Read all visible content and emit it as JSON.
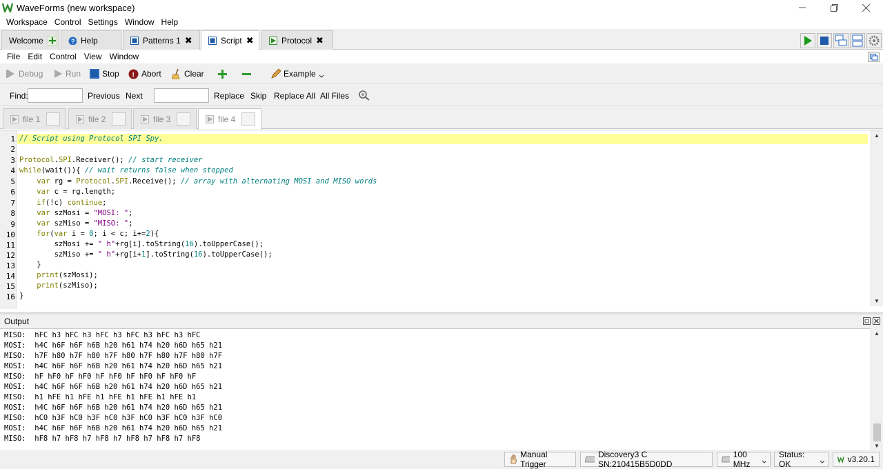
{
  "window": {
    "title": "WaveForms (new workspace)",
    "minimize_icon": "minimize-icon",
    "restore_icon": "restore-icon",
    "close_icon": "close-icon"
  },
  "app_menu": [
    "Workspace",
    "Control",
    "Settings",
    "Window",
    "Help"
  ],
  "tabs": [
    {
      "label": "Welcome"
    },
    {
      "label": "Help"
    },
    {
      "label": "Patterns 1"
    },
    {
      "label": "Script"
    },
    {
      "label": "Protocol"
    }
  ],
  "script_menu": [
    "File",
    "Edit",
    "Control",
    "View",
    "Window"
  ],
  "toolbar": {
    "debug": "Debug",
    "run": "Run",
    "stop": "Stop",
    "abort": "Abort",
    "clear": "Clear",
    "example": "Example"
  },
  "find_bar": {
    "find_label": "Find:",
    "find_value": "",
    "previous": "Previous",
    "next": "Next",
    "replace_value": "",
    "replace": "Replace",
    "skip": "Skip",
    "replace_all": "Replace All",
    "all_files": "All Files"
  },
  "file_tabs": [
    "file 1",
    "file 2",
    "file 3",
    "file 4"
  ],
  "code_lines": [
    "1",
    "2",
    "3",
    "4",
    "5",
    "6",
    "7",
    "8",
    "9",
    "10",
    "11",
    "12",
    "13",
    "14",
    "15",
    "16"
  ],
  "output": {
    "title": "Output",
    "lines": [
      "MISO:  hFC h3 hFC h3 hFC h3 hFC h3 hFC h3 hFC",
      "MOSI:  h4C h6F h6F h6B h20 h61 h74 h20 h6D h65 h21",
      "MISO:  h7F h80 h7F h80 h7F h80 h7F h80 h7F h80 h7F",
      "MOSI:  h4C h6F h6F h6B h20 h61 h74 h20 h6D h65 h21",
      "MISO:  hF hF0 hF hF0 hF hF0 hF hF0 hF hF0 hF",
      "MOSI:  h4C h6F h6F h6B h20 h61 h74 h20 h6D h65 h21",
      "MISO:  h1 hFE h1 hFE h1 hFE h1 hFE h1 hFE h1",
      "MOSI:  h4C h6F h6F h6B h20 h61 h74 h20 h6D h65 h21",
      "MISO:  hC0 h3F hC0 h3F hC0 h3F hC0 h3F hC0 h3F hC0",
      "MOSI:  h4C h6F h6F h6B h20 h61 h74 h20 h6D h65 h21",
      "MISO:  hF8 h7 hF8 h7 hF8 h7 hF8 h7 hF8 h7 hF8"
    ]
  },
  "status_bar": {
    "trigger": "Manual Trigger",
    "device": "Discovery3 C SN:210415B5D0DD",
    "clock": "100 MHz",
    "status": "Status: OK",
    "version": "v3.20.1"
  },
  "colors": {
    "highlight": "#ffff99",
    "comment": "#008080",
    "keyword": "#808000",
    "string": "#800080",
    "run_green": "#1a9a1a",
    "stop_blue": "#1d5aa8"
  }
}
